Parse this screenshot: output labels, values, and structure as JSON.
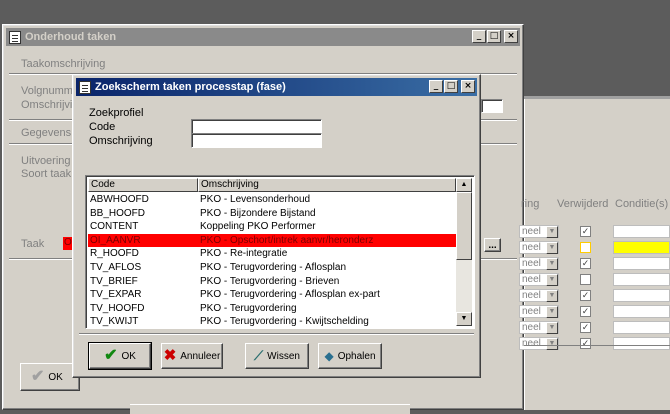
{
  "back_window": {
    "title": "Onderhoud taken",
    "labels": {
      "taakomschrijving": "Taakomschrijving",
      "volgnummer": "Volgnumm",
      "omschrijving": "Omschrijvi",
      "gegevens": "Gegevens t",
      "uitvoering": "Uitvoering",
      "soort_taak": "Soort taak",
      "taak": "Taak"
    },
    "taak_value": "O",
    "ok_button": "OK",
    "browse_button": "..."
  },
  "right_grid": {
    "headers": {
      "col_a": "ring",
      "verwijderd": "Verwijderd",
      "conditie": "Conditie(s)"
    },
    "cell_text": "neel",
    "rows": [
      {
        "verwijderd": true,
        "highlight": false
      },
      {
        "verwijderd": false,
        "highlight": true
      },
      {
        "verwijderd": true,
        "highlight": false
      },
      {
        "verwijderd": false,
        "highlight": false
      },
      {
        "verwijderd": true,
        "highlight": false
      },
      {
        "verwijderd": true,
        "highlight": false
      },
      {
        "verwijderd": true,
        "highlight": false
      },
      {
        "verwijderd": true,
        "highlight": false
      }
    ],
    "colors": {
      "highlight": "#ffff00",
      "selected_cell": "#ffff00"
    }
  },
  "dialog": {
    "title": "Zoekscherm taken processtap (fase)",
    "section_label": "Zoekprofiel",
    "code_label": "Code",
    "code_value": "",
    "omschrijving_label": "Omschrijving",
    "omschrijving_value": "",
    "columns": {
      "code": "Code",
      "omschrijving": "Omschrijving"
    },
    "rows": [
      {
        "code": "ABWHOOFD",
        "omschrijving": "PKO - Levensonderhoud"
      },
      {
        "code": "BB_HOOFD",
        "omschrijving": "PKO - Bijzondere Bijstand"
      },
      {
        "code": "CONTENT",
        "omschrijving": "Koppeling PKO Performer"
      },
      {
        "code": "OI_AANVR",
        "omschrijving": "PKO - Opschort/intrek aanvr/heronderz",
        "selected": true
      },
      {
        "code": "R_HOOFD",
        "omschrijving": "PKO - Re-integratie"
      },
      {
        "code": "TV_AFLOS",
        "omschrijving": "PKO - Terugvordering - Aflosplan"
      },
      {
        "code": "TV_BRIEF",
        "omschrijving": "PKO - Terugvordering - Brieven"
      },
      {
        "code": "TV_EXPAR",
        "omschrijving": "PKO - Terugvordering - Aflosplan ex-part"
      },
      {
        "code": "TV_HOOFD",
        "omschrijving": "PKO - Terugvordering"
      },
      {
        "code": "TV_KWIJT",
        "omschrijving": "PKO - Terugvordering - Kwijtschelding"
      }
    ],
    "buttons": {
      "ok": "OK",
      "annuleer": "Annuleer",
      "wissen": "Wissen",
      "ophalen": "Ophalen"
    },
    "icons": {
      "ok": "checkmark-icon",
      "annuleer": "red-x-icon",
      "wissen": "eraser-icon",
      "ophalen": "fetch-icon"
    },
    "colors": {
      "selected_row": "#ff0000",
      "titlebar": "#0a246a"
    }
  }
}
